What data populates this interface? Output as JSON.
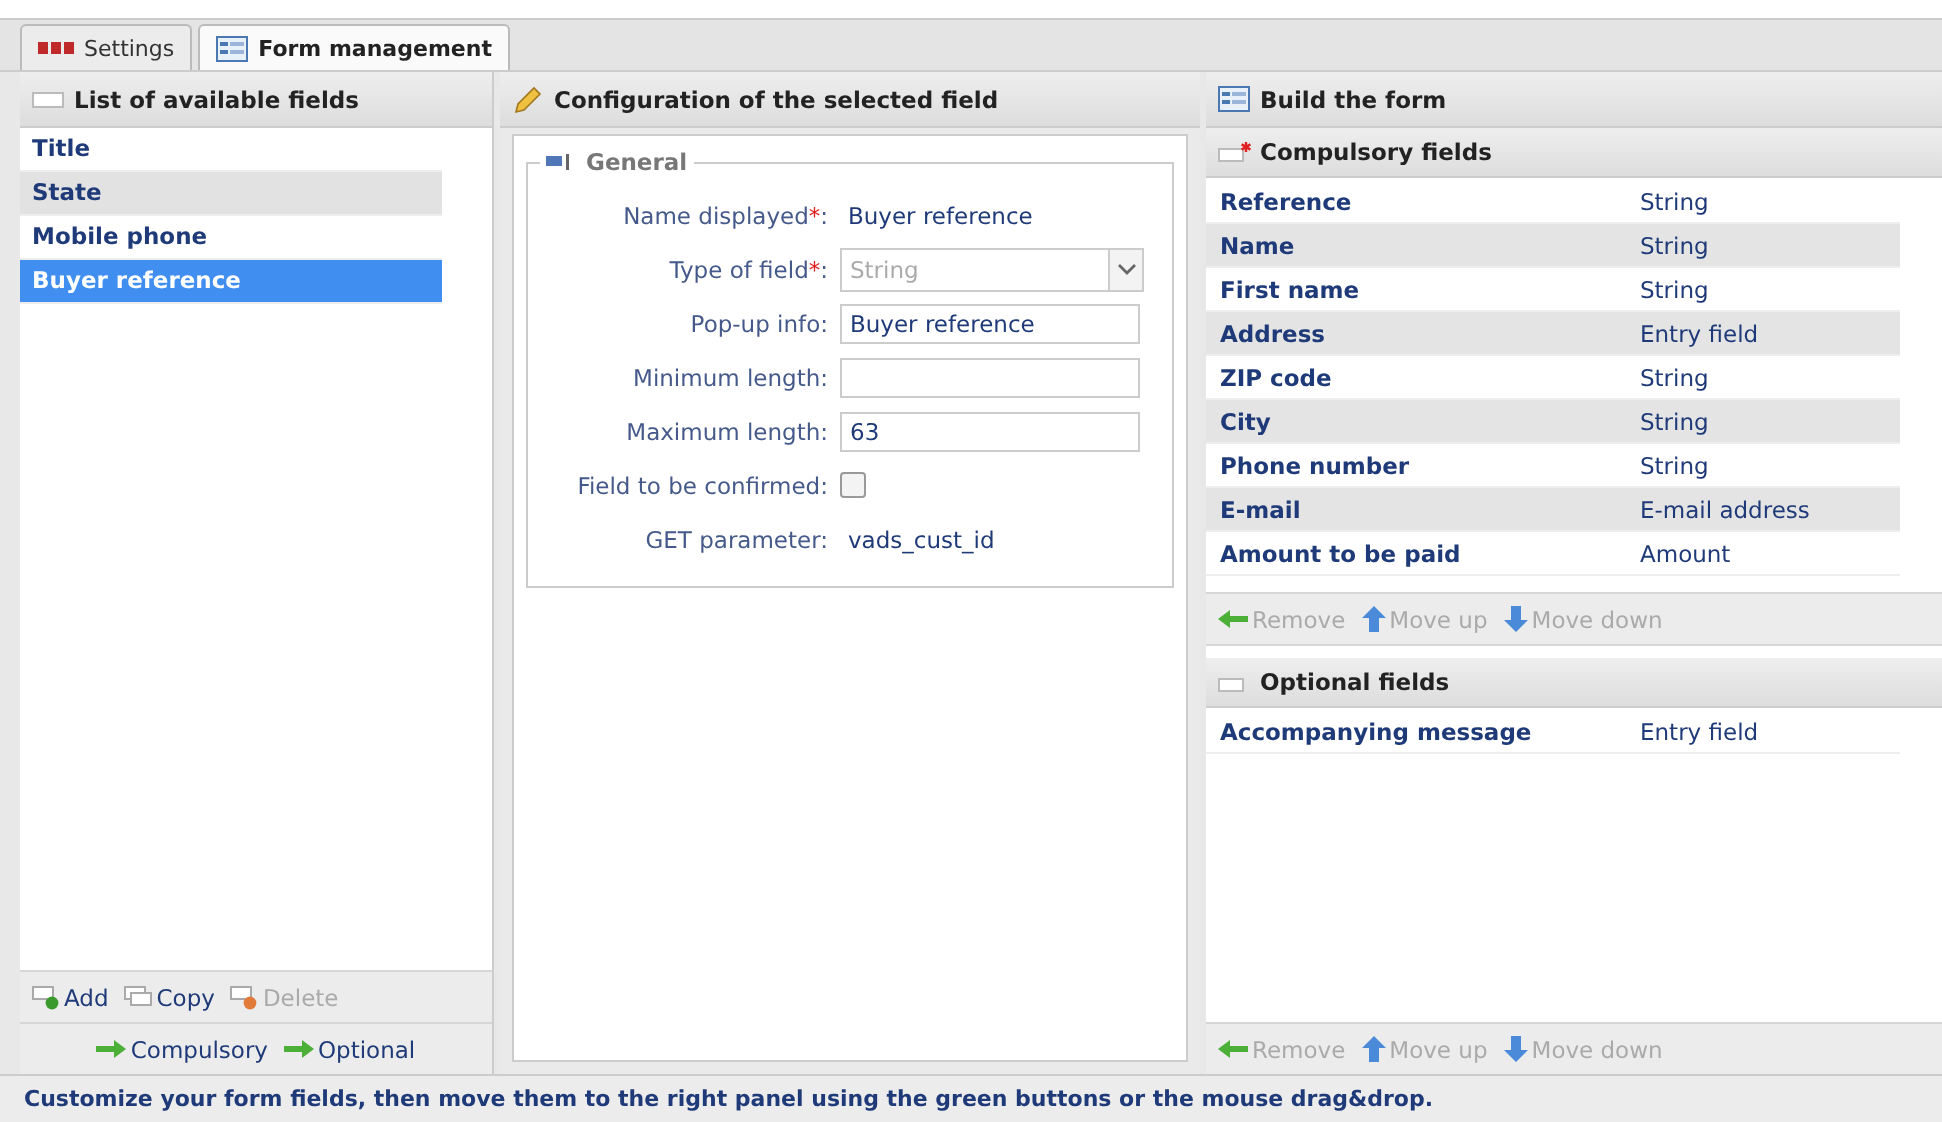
{
  "tabs": [
    {
      "label": "Settings",
      "selected": false
    },
    {
      "label": "Form management",
      "selected": true
    }
  ],
  "available_fields": {
    "title": "List of available fields",
    "items": [
      {
        "label": "Title",
        "selected": false
      },
      {
        "label": "State",
        "selected": false
      },
      {
        "label": "Mobile phone",
        "selected": false
      },
      {
        "label": "Buyer reference",
        "selected": true
      }
    ],
    "toolbar": [
      {
        "label": "Add",
        "kind": "add",
        "disabled": false
      },
      {
        "label": "Copy",
        "kind": "copy",
        "disabled": false
      },
      {
        "label": "Delete",
        "kind": "delete",
        "disabled": true
      }
    ],
    "move_buttons": [
      {
        "label": "Compulsory"
      },
      {
        "label": "Optional"
      }
    ]
  },
  "configuration": {
    "title": "Configuration of the selected field",
    "legend": "General",
    "rows": [
      {
        "label": "Name displayed",
        "star": "*",
        "colon": ":",
        "kind": "text",
        "value": "Buyer reference"
      },
      {
        "label": "Type of field",
        "star": "*",
        "colon": ":",
        "kind": "select",
        "value": "String",
        "disabled": true
      },
      {
        "label": "Pop-up info:",
        "kind": "input",
        "value": "Buyer reference"
      },
      {
        "label": "Minimum length:",
        "kind": "input"
      },
      {
        "label": "Maximum length:",
        "kind": "input",
        "value": "63"
      },
      {
        "label": "Field to be confirmed:",
        "kind": "checkbox",
        "checked": false
      },
      {
        "label": "GET parameter:",
        "kind": "text",
        "value": "vads_cust_id"
      }
    ]
  },
  "build": {
    "title": "Build the form",
    "compulsory": {
      "title": "Compulsory fields",
      "rows": [
        {
          "name": "Reference",
          "type": "String"
        },
        {
          "name": "Name",
          "type": "String"
        },
        {
          "name": "First name",
          "type": "String"
        },
        {
          "name": "Address",
          "type": "Entry field"
        },
        {
          "name": "ZIP code",
          "type": "String"
        },
        {
          "name": "City",
          "type": "String"
        },
        {
          "name": "Phone number",
          "type": "String"
        },
        {
          "name": "E-mail",
          "type": "E-mail address"
        },
        {
          "name": "Amount to be paid",
          "type": "Amount"
        }
      ],
      "toolbar": [
        {
          "label": "Remove",
          "kind": "remove",
          "disabled": true
        },
        {
          "label": "Move up",
          "kind": "up",
          "disabled": true
        },
        {
          "label": "Move down",
          "kind": "down",
          "disabled": true
        }
      ]
    },
    "optional": {
      "title": "Optional fields",
      "rows": [
        {
          "name": "Accompanying message",
          "type": "Entry field"
        }
      ],
      "toolbar": [
        {
          "label": "Remove",
          "kind": "remove",
          "disabled": true
        },
        {
          "label": "Move up",
          "kind": "up",
          "disabled": true
        },
        {
          "label": "Move down",
          "kind": "down",
          "disabled": true
        }
      ]
    }
  },
  "status_bar": "Customize your form fields, then move them to the right panel using the green buttons or the mouse drag&drop."
}
